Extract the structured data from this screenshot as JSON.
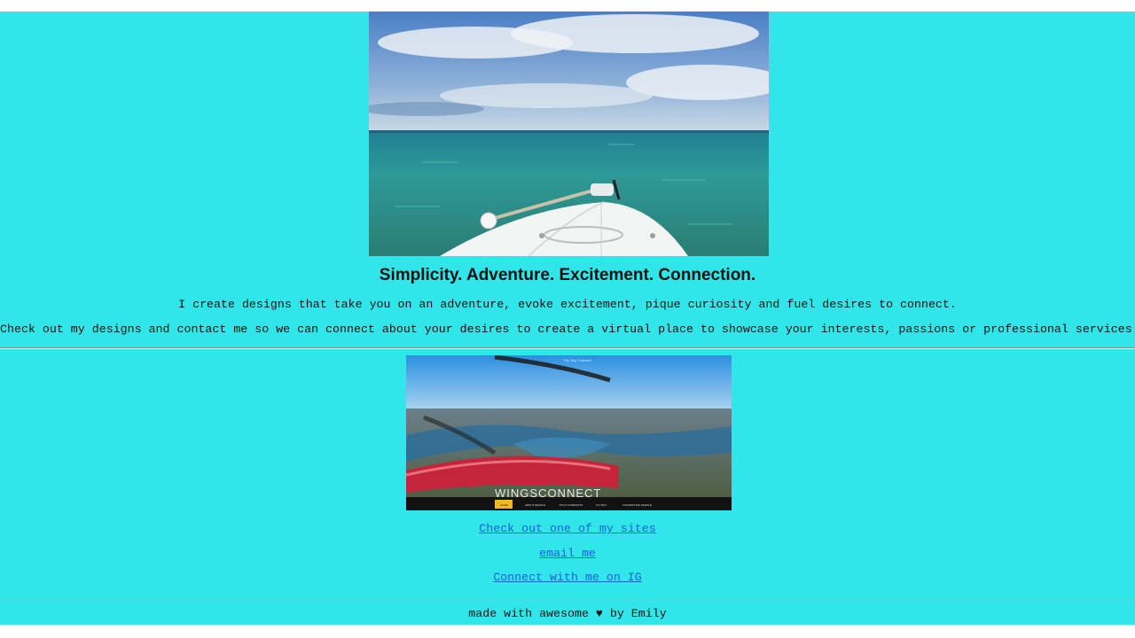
{
  "hero": {
    "alt": "Boat bow heading into open turquoise sea"
  },
  "headline": "Simplicity. Adventure. Excitement. Connection.",
  "paragraphs": [
    "I create designs that take you on an adventure, evoke excitement, pique curiosity and fuel desires to connect.",
    "Check out my designs and contact me so we can connect about your desires to create a virtual place to showcase your interests, passions or professional services."
  ],
  "site_preview": {
    "brand": "WINGSCONNECT",
    "tiny_title": "Fly. Sky. Connect",
    "nav": [
      "HOME",
      "ABOUT PEOPLE",
      "PILOT INTERESTS",
      "FLY BOY",
      "CONNECTING PEOPLE"
    ]
  },
  "links": {
    "sites": "Check out one of my sites",
    "email": "email me",
    "ig": "Connect with me on IG"
  },
  "footer": {
    "credit": "made with awesome ♥ by Emily"
  },
  "colors": {
    "background": "#30e6e8",
    "link": "#1a5fe0"
  }
}
